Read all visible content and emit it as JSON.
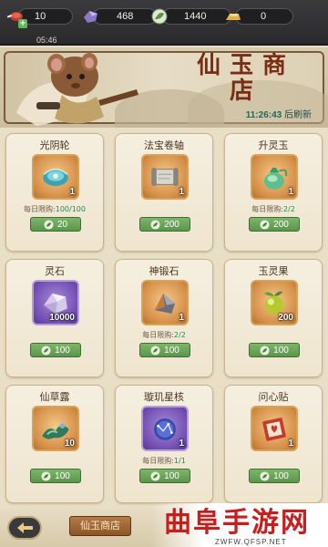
{
  "resources": {
    "stamina": {
      "value": "10",
      "timer": "05:46",
      "icon": "meat-icon"
    },
    "crystal": {
      "value": "468",
      "icon": "purple-crystal-icon"
    },
    "leaf": {
      "value": "1440",
      "icon": "jade-leaf-icon"
    },
    "gold": {
      "value": "0",
      "icon": "gold-bar-icon"
    }
  },
  "banner": {
    "title": "仙玉商店",
    "refresh_time": "11:26:43",
    "refresh_suffix": "后刷新"
  },
  "shop": {
    "items": [
      {
        "name": "光阴轮",
        "qty": "1",
        "limit_label": "每日限购:",
        "limit": "100/100",
        "price": "20",
        "frame": "orange",
        "icon": "time-wheel-icon"
      },
      {
        "name": "法宝卷轴",
        "qty": "1",
        "limit_label": "",
        "limit": "",
        "price": "200",
        "frame": "orange",
        "icon": "scroll-icon"
      },
      {
        "name": "升灵玉",
        "qty": "1",
        "limit_label": "每日限购:",
        "limit": "2/2",
        "price": "200",
        "frame": "orange",
        "icon": "jade-pouch-icon"
      },
      {
        "name": "灵石",
        "qty": "10000",
        "limit_label": "",
        "limit": "",
        "price": "100",
        "frame": "purple",
        "icon": "spirit-stone-icon"
      },
      {
        "name": "神锻石",
        "qty": "1",
        "limit_label": "每日限购:",
        "limit": "2/2",
        "price": "100",
        "frame": "orange",
        "icon": "forge-stone-icon"
      },
      {
        "name": "玉灵果",
        "qty": "200",
        "limit_label": "",
        "limit": "",
        "price": "100",
        "frame": "orange",
        "icon": "spirit-fruit-icon"
      },
      {
        "name": "仙草露",
        "qty": "10",
        "limit_label": "",
        "limit": "",
        "price": "100",
        "frame": "orange",
        "icon": "herb-dew-icon"
      },
      {
        "name": "璇玑星核",
        "qty": "1",
        "limit_label": "每日限购:",
        "limit": "1/1",
        "price": "100",
        "frame": "purple",
        "icon": "star-core-icon"
      },
      {
        "name": "问心贴",
        "qty": "1",
        "limit_label": "",
        "limit": "",
        "price": "100",
        "frame": "orange",
        "icon": "heart-talisman-icon"
      }
    ]
  },
  "bottom": {
    "tab_label": "仙玉商店",
    "back_icon": "back-arrow-icon"
  },
  "watermark": {
    "title": "曲阜手游网",
    "url": "ZWFW.QFSP.NET"
  },
  "colors": {
    "accent_green": "#5b954c",
    "title_red": "#7b2c14",
    "card_bg": "#f3ecdb"
  }
}
